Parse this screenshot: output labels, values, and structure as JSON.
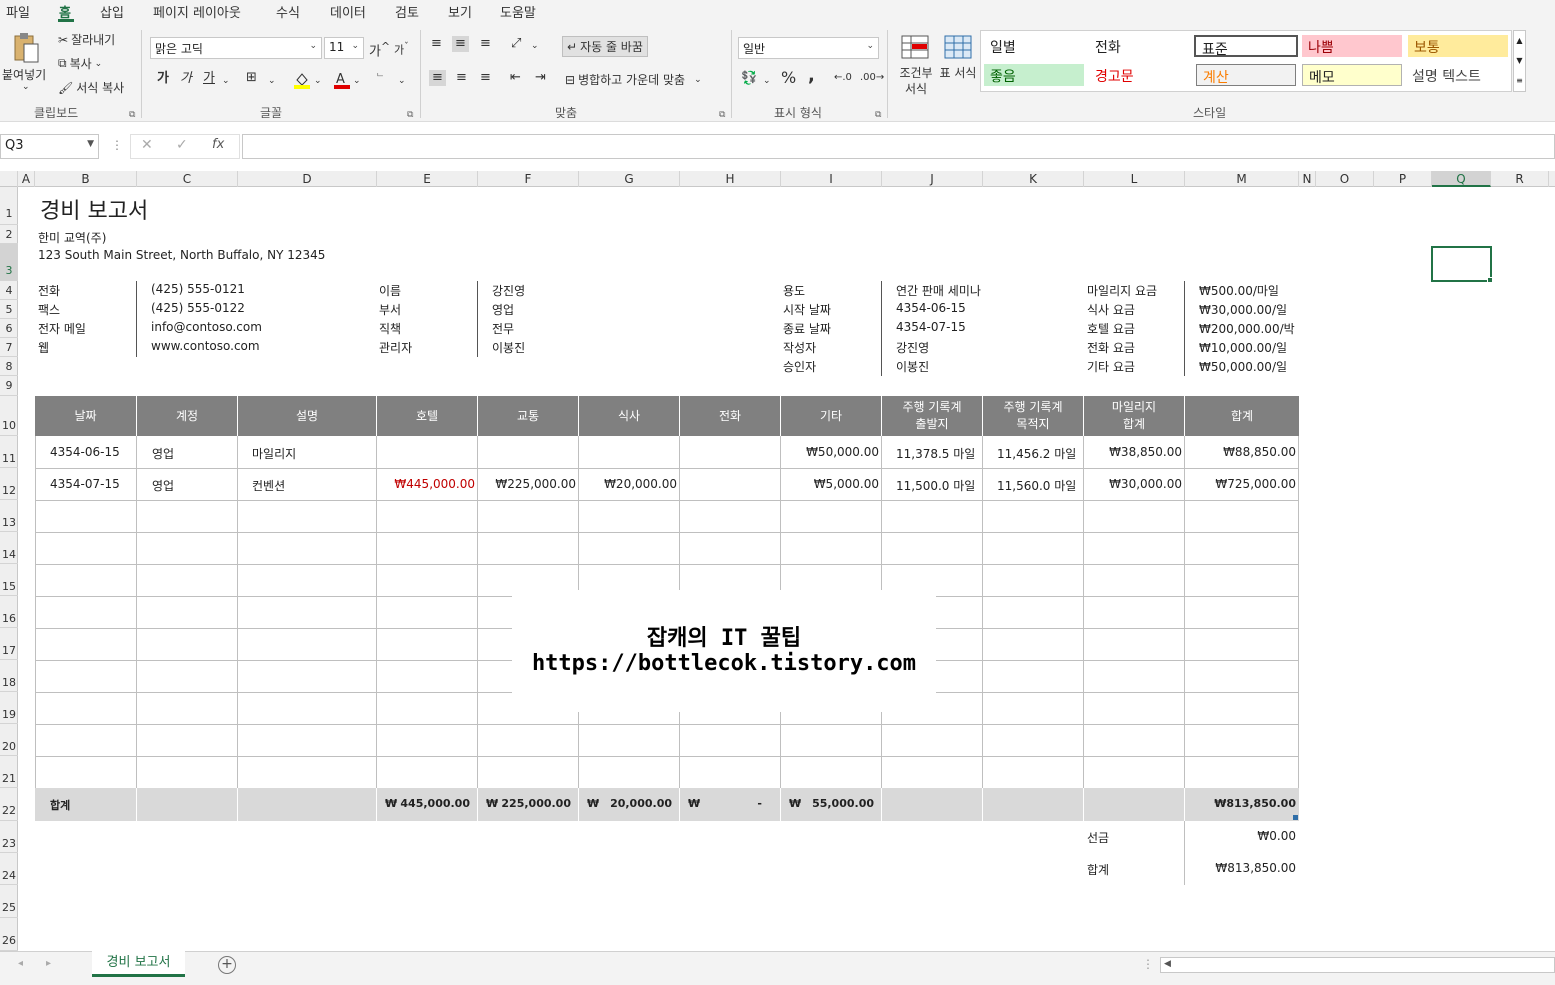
{
  "menu": [
    "파일",
    "홈",
    "삽입",
    "페이지 레이아웃",
    "수식",
    "데이터",
    "검토",
    "보기",
    "도움말"
  ],
  "ribbon": {
    "clipboard": {
      "paste": "붙여넣기",
      "cut": "잘라내기",
      "copy": "복사",
      "format_painter": "서식 복사",
      "group": "클립보드"
    },
    "font": {
      "name": "맑은 고딕",
      "size": "11",
      "group": "글꼴",
      "bold": "가",
      "italic": "가",
      "underline": "가",
      "grow": "가",
      "shrink": "가"
    },
    "alignment": {
      "wrap": "자동 줄 바꿈",
      "merge": "병합하고 가운데 맞춤",
      "group": "맞춤"
    },
    "number": {
      "format": "일반",
      "percent": "%",
      "comma": ",",
      "group": "표시 형식"
    },
    "styles": {
      "conditional": "조건부 서식",
      "table": "표 서식",
      "group": "스타일",
      "cells": [
        "일별",
        "전화",
        "표준",
        "나쁨",
        "보통",
        "좋음",
        "경고문",
        "계산",
        "메모",
        "설명 텍스트"
      ]
    }
  },
  "formula_bar": {
    "name_box": "Q3",
    "fx": "fx"
  },
  "columns": [
    "A",
    "B",
    "C",
    "D",
    "E",
    "F",
    "G",
    "H",
    "I",
    "J",
    "K",
    "L",
    "M",
    "N",
    "O",
    "P",
    "Q",
    "R"
  ],
  "rows": [
    "1",
    "2",
    "3",
    "4",
    "5",
    "6",
    "7",
    "8",
    "9",
    "10",
    "11",
    "12",
    "13",
    "14",
    "15",
    "16",
    "17",
    "18",
    "19",
    "20",
    "21",
    "22",
    "23",
    "24",
    "25",
    "26"
  ],
  "sheet": {
    "title": "경비 보고서",
    "company": "한미 교역(주)",
    "address": "123 South Main Street, North Buffalo, NY 12345",
    "contact_labels": [
      "전화",
      "팩스",
      "전자 메일",
      "웹"
    ],
    "contact_values": [
      "(425) 555-0121",
      "(425) 555-0122",
      "info@contoso.com",
      "www.contoso.com"
    ],
    "person_labels": [
      "이름",
      "부서",
      "직책",
      "관리자"
    ],
    "person_values": [
      "강진영",
      "영업",
      "전무",
      "이봉진"
    ],
    "trip_labels": [
      "용도",
      "시작 날짜",
      "종료 날짜",
      "작성자",
      "승인자"
    ],
    "trip_values": [
      "연간 판매 세미나",
      "4354-06-15",
      "4354-07-15",
      "강진영",
      "이봉진"
    ],
    "rate_labels": [
      "마일리지 요금",
      "식사 요금",
      "호텔 요금",
      "전화 요금",
      "기타 요금"
    ],
    "rate_values": [
      "₩500.00/마일",
      "₩30,000.00/일",
      "₩200,000.00/박",
      "₩10,000.00/일",
      "₩50,000.00/일"
    ],
    "table_headers": [
      "날짜",
      "계정",
      "설명",
      "호텔",
      "교통",
      "식사",
      "전화",
      "기타",
      "주행 기록계\n출발지",
      "주행 기록계\n목적지",
      "마일리지\n합계",
      "합계"
    ],
    "table_rows": [
      [
        "4354-06-15",
        "영업",
        "마일리지",
        "",
        "",
        "",
        "",
        "₩50,000.00",
        "11,378.5 마일",
        "11,456.2 마일",
        "₩38,850.00",
        "₩88,850.00"
      ],
      [
        "4354-07-15",
        "영업",
        "컨벤션",
        "₩445,000.00",
        "₩225,000.00",
        "₩20,000.00",
        "",
        "₩5,000.00",
        "11,500.0 마일",
        "11,560.0 마일",
        "₩30,000.00",
        "₩725,000.00"
      ]
    ],
    "total_label": "합계",
    "totals": [
      "445,000.00",
      "225,000.00",
      "20,000.00",
      "-",
      "55,000.00"
    ],
    "currency": "₩",
    "grand_total": "₩813,850.00",
    "advance_label": "선금",
    "advance_value": "₩0.00",
    "final_label": "합계",
    "final_value": "₩813,850.00"
  },
  "watermark": {
    "line1": "잡캐의 IT 꿀팁",
    "line2": "https://bottlecok.tistory.com"
  },
  "sheet_tab": "경비 보고서",
  "colors": {
    "accent": "#217346",
    "header_bg": "#808080",
    "total_bg": "#d9d9d9",
    "negative": "#c00000"
  }
}
